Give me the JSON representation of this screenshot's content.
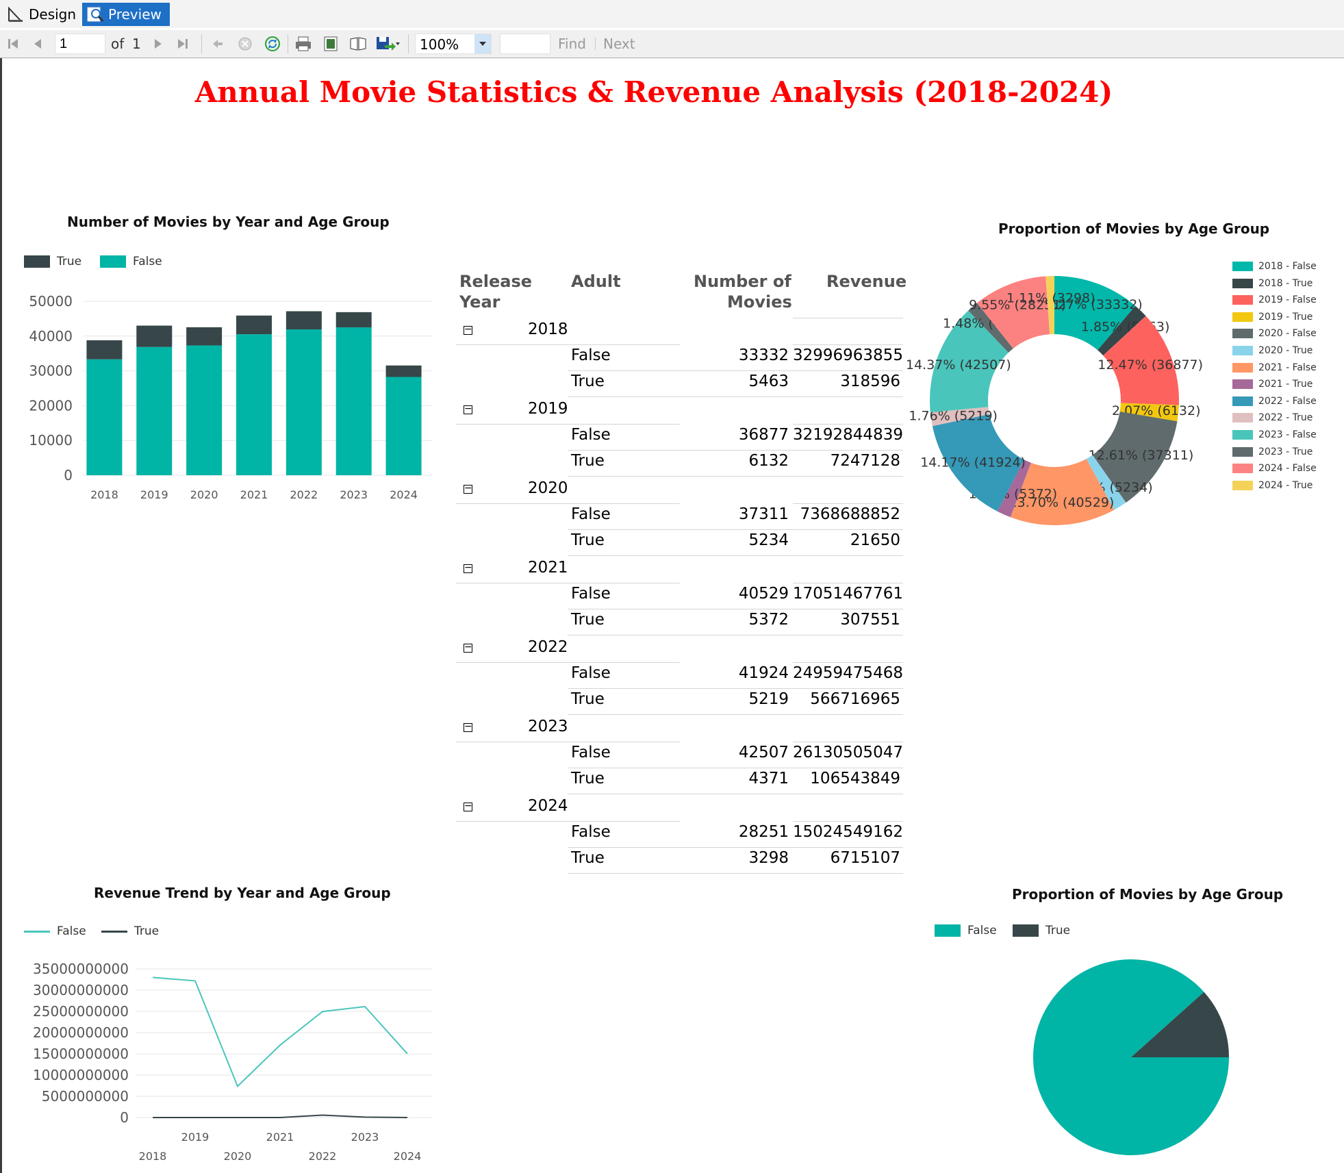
{
  "tabs": [
    {
      "label": "Design",
      "icon": "design-icon"
    },
    {
      "label": "Preview",
      "icon": "preview-icon"
    }
  ],
  "toolbar": {
    "page_value": "1",
    "of_label": "of",
    "total_pages": "1",
    "zoom": "100%",
    "find_label": "Find",
    "next_label": "Next",
    "icons": [
      "first-page-icon",
      "previous-page-icon",
      "next-page-icon",
      "last-page-icon",
      "back-icon",
      "stop-icon",
      "refresh-icon",
      "print-icon",
      "print-layout-icon",
      "page-setup-icon",
      "export-icon"
    ]
  },
  "report": {
    "title": "Annual Movie Statistics & Revenue Analysis (2018-2024)"
  },
  "colors": {
    "teal": "#00b4a6",
    "dark": "#374649",
    "title_red": "#ff0000"
  },
  "matrix": {
    "headers": {
      "year": [
        "Release",
        "Year"
      ],
      "adult": "Adult",
      "movies": [
        "Number of",
        "Movies"
      ],
      "revenue": "Revenue"
    },
    "groups": [
      {
        "year": "2018",
        "rows": [
          {
            "adult": "False",
            "movies": "33332",
            "revenue": "32996963855"
          },
          {
            "adult": "True",
            "movies": "5463",
            "revenue": "318596"
          }
        ]
      },
      {
        "year": "2019",
        "rows": [
          {
            "adult": "False",
            "movies": "36877",
            "revenue": "32192844839"
          },
          {
            "adult": "True",
            "movies": "6132",
            "revenue": "7247128"
          }
        ]
      },
      {
        "year": "2020",
        "rows": [
          {
            "adult": "False",
            "movies": "37311",
            "revenue": "7368688852"
          },
          {
            "adult": "True",
            "movies": "5234",
            "revenue": "21650"
          }
        ]
      },
      {
        "year": "2021",
        "rows": [
          {
            "adult": "False",
            "movies": "40529",
            "revenue": "17051467761"
          },
          {
            "adult": "True",
            "movies": "5372",
            "revenue": "307551"
          }
        ]
      },
      {
        "year": "2022",
        "rows": [
          {
            "adult": "False",
            "movies": "41924",
            "revenue": "24959475468"
          },
          {
            "adult": "True",
            "movies": "5219",
            "revenue": "566716965"
          }
        ]
      },
      {
        "year": "2023",
        "rows": [
          {
            "adult": "False",
            "movies": "42507",
            "revenue": "26130505047"
          },
          {
            "adult": "True",
            "movies": "4371",
            "revenue": "106543849"
          }
        ]
      },
      {
        "year": "2024",
        "rows": [
          {
            "adult": "False",
            "movies": "28251",
            "revenue": "15024549162"
          },
          {
            "adult": "True",
            "movies": "3298",
            "revenue": "6715107"
          }
        ]
      }
    ]
  },
  "chart_data": [
    {
      "type": "bar",
      "stacked": true,
      "title": "Number of Movies by Year and Age Group",
      "categories": [
        "2018",
        "2019",
        "2020",
        "2021",
        "2022",
        "2023",
        "2024"
      ],
      "series": [
        {
          "name": "True",
          "color": "#374649",
          "values": [
            5463,
            6132,
            5234,
            5372,
            5219,
            4371,
            3298
          ]
        },
        {
          "name": "False",
          "color": "#00b4a6",
          "values": [
            33332,
            36877,
            37311,
            40529,
            41924,
            42507,
            28251
          ]
        }
      ],
      "legend_order": [
        "True",
        "False"
      ],
      "legend_position": "top-left",
      "ylim": [
        0,
        50000
      ],
      "yticks": [
        "0",
        "10000",
        "20000",
        "30000",
        "40000",
        "50000"
      ],
      "grid": true
    },
    {
      "type": "pie",
      "donut": true,
      "title": "Proportion of Movies by Age Group",
      "legend_position": "right",
      "slices": [
        {
          "label": "2018 - False",
          "value": 33332,
          "percent": "11.27%",
          "color": "#01b8aa"
        },
        {
          "label": "2018 - True",
          "value": 5463,
          "percent": "1.85%",
          "color": "#374649"
        },
        {
          "label": "2019 - False",
          "value": 36877,
          "percent": "12.47%",
          "color": "#fd625e"
        },
        {
          "label": "2019 - True",
          "value": 6132,
          "percent": "2.07%",
          "color": "#f2c80f"
        },
        {
          "label": "2020 - False",
          "value": 37311,
          "percent": "12.61%",
          "color": "#5f6b6d"
        },
        {
          "label": "2020 - True",
          "value": 5234,
          "percent": "1.77%",
          "color": "#8ad4eb"
        },
        {
          "label": "2021 - False",
          "value": 40529,
          "percent": "13.70%",
          "color": "#fe9666"
        },
        {
          "label": "2021 - True",
          "value": 5372,
          "percent": "1.82%",
          "color": "#a66999"
        },
        {
          "label": "2022 - False",
          "value": 41924,
          "percent": "14.17%",
          "color": "#3599b8"
        },
        {
          "label": "2022 - True",
          "value": 5219,
          "percent": "1.76%",
          "color": "#dfbfbf"
        },
        {
          "label": "2023 - False",
          "value": 42507,
          "percent": "14.37%",
          "color": "#4ac5bb"
        },
        {
          "label": "2023 - True",
          "value": 4371,
          "percent": "1.48%",
          "color": "#5f6b6d"
        },
        {
          "label": "2024 - False",
          "value": 28251,
          "percent": "9.55%",
          "color": "#fb8281"
        },
        {
          "label": "2024 - True",
          "value": 3298,
          "percent": "1.11%",
          "color": "#f4d25a"
        }
      ]
    },
    {
      "type": "line",
      "title": "Revenue Trend by Year and Age Group",
      "x": [
        "2018",
        "2019",
        "2020",
        "2021",
        "2022",
        "2023",
        "2024"
      ],
      "xticks_upper": [
        "2019",
        "2021",
        "2023"
      ],
      "xticks_lower": [
        "2018",
        "2020",
        "2022",
        "2024"
      ],
      "series": [
        {
          "name": "False",
          "color": "#4ac5bb",
          "values": [
            32996963855,
            32192844839,
            7368688852,
            17051467761,
            24959475468,
            26130505047,
            15024549162
          ]
        },
        {
          "name": "True",
          "color": "#374649",
          "values": [
            318596,
            7247128,
            21650,
            307551,
            566716965,
            106543849,
            6715107
          ]
        }
      ],
      "legend_position": "top-left",
      "ylim": [
        0,
        35000000000
      ],
      "yticks": [
        "0",
        "5000000000",
        "10000000000",
        "15000000000",
        "20000000000",
        "25000000000",
        "30000000000",
        "35000000000"
      ],
      "grid": true
    },
    {
      "type": "pie",
      "title": "Proportion of Movies by Age Group",
      "legend_position": "top",
      "slices": [
        {
          "label": "False",
          "value": 266731,
          "color": "#00b4a6"
        },
        {
          "label": "True",
          "value": 35089,
          "color": "#374649"
        }
      ]
    }
  ]
}
